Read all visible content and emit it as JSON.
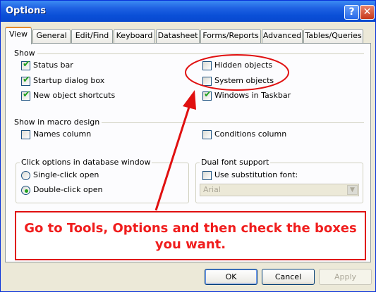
{
  "window": {
    "title": "Options",
    "help_glyph": "?",
    "close_glyph": "✕"
  },
  "tabs": [
    {
      "label": "View",
      "active": true
    },
    {
      "label": "General"
    },
    {
      "label": "Edit/Find"
    },
    {
      "label": "Keyboard"
    },
    {
      "label": "Datasheet"
    },
    {
      "label": "Forms/Reports"
    },
    {
      "label": "Advanced"
    },
    {
      "label": "Tables/Queries"
    }
  ],
  "show": {
    "heading": "Show",
    "status_bar": {
      "label": "Status bar",
      "checked": true
    },
    "startup_dialog": {
      "label": "Startup dialog box",
      "checked": true
    },
    "new_object_shortcuts": {
      "label": "New object shortcuts",
      "checked": true
    },
    "hidden_objects": {
      "label": "Hidden objects",
      "checked": false
    },
    "system_objects": {
      "label": "System objects",
      "checked": false
    },
    "windows_in_taskbar": {
      "label": "Windows in Taskbar",
      "checked": true
    }
  },
  "macro": {
    "heading": "Show in macro design",
    "names_column": {
      "label": "Names column",
      "checked": false
    },
    "conditions_column": {
      "label": "Conditions column",
      "checked": false
    }
  },
  "click_options": {
    "heading": "Click options in database window",
    "single_click": {
      "label": "Single-click open",
      "selected": false
    },
    "double_click": {
      "label": "Double-click open",
      "selected": true
    }
  },
  "dual_font": {
    "heading": "Dual font support",
    "use_substitution": {
      "label": "Use substitution font:",
      "checked": false
    },
    "font_value": "Arial"
  },
  "buttons": {
    "ok": "OK",
    "cancel": "Cancel",
    "apply": "Apply"
  },
  "annotation": {
    "line1": "Go to Tools, Options and then check the boxes",
    "line2": "you want.",
    "color": "#f01d1d"
  },
  "glyphs": {
    "check": "✔",
    "dropdown": "▼"
  }
}
